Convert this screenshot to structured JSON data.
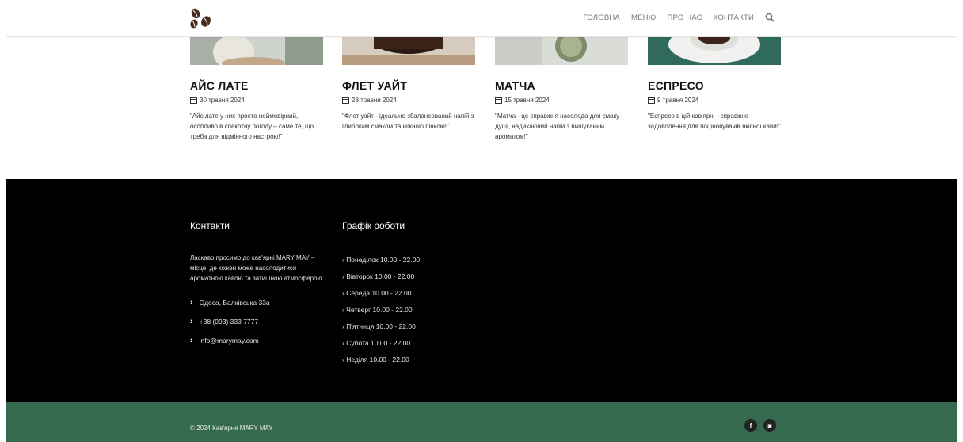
{
  "nav": {
    "items": [
      "ГОЛОВНА",
      "МЕНЮ",
      "ПРО НАС",
      "КОНТАКТИ"
    ]
  },
  "posts": [
    {
      "title": "АЙС ЛАТЕ",
      "date": "30 травня 2024",
      "text": "\"Айс лате у них просто неймовірний, особливо в спекотну погоду – саме те, що треба для відмінного настрою!\""
    },
    {
      "title": "ФЛЕТ УАЙТ",
      "date": "28 травня 2024",
      "text": "\"Флет уайт - ідеально збалансований напій з глибоким смаком та ніжною пінкою!\""
    },
    {
      "title": "МАТЧА",
      "date": "15 травня 2024",
      "text": "\"Матча - це справжня насолода для смаку і душі, надихаючий напій з вишуканим ароматом!\""
    },
    {
      "title": "ЕСПРЕСО",
      "date": "9 травня 2024",
      "text": "\"Еспресо в цій кав'ярні - справжнє задоволення для поціновувачів якісної кави!\""
    }
  ],
  "footer": {
    "contacts_title": "Контакти",
    "intro": "Ласкаво просимо до кав'ярні MARY MAY – місце, де кожен може насолодитися ароматною кавою та затишною атмосферою.",
    "address": "Одеса, Балківська 33а",
    "phone": "+38 (093) 333 7777",
    "email": "info@marymay.com",
    "hours_title": "Графік роботи",
    "hours": [
      "› Понеділок 10.00 - 22.00",
      "› Вівторок 10.00 - 22.00",
      "› Середа 10.00 - 22.00",
      "› Четверг 10.00 - 22.00",
      "› П'ятниця 10.00 - 22.00",
      "› Субота 10.00 - 22.00",
      "› Неділя 10.00 - 22.00"
    ],
    "copyright": "© 2024 Кав'ярня MARY MAY",
    "social": [
      {
        "icon": "facebook-icon",
        "glyph": "f"
      },
      {
        "icon": "instagram-icon",
        "glyph": "◙"
      }
    ]
  },
  "colors": {
    "footer_dark": "#000000",
    "footer_green": "#356a4e",
    "accent": "#2e6b4d"
  }
}
